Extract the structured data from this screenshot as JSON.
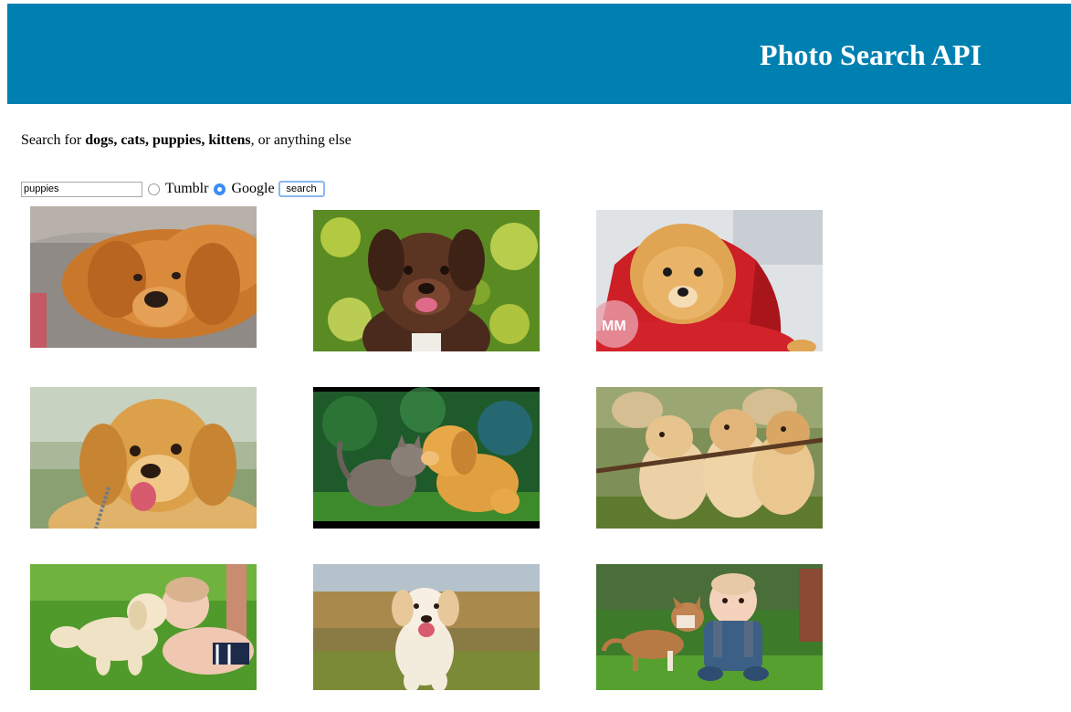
{
  "header": {
    "title": "Photo Search API"
  },
  "intro": {
    "prefix": "Search for ",
    "keywords": "dogs, cats, puppies, kittens",
    "suffix": ", or anything else"
  },
  "search": {
    "query": "puppies",
    "sources": [
      {
        "label": "Tumblr",
        "selected": false
      },
      {
        "label": "Google",
        "selected": true
      }
    ],
    "button_label": "search"
  },
  "results": [
    {
      "icon": "golden-puppy-lying-photo"
    },
    {
      "icon": "brown-puppy-bokeh-photo"
    },
    {
      "icon": "pomeranian-red-hoodie-photo"
    },
    {
      "icon": "golden-retriever-puppy-smiling-photo"
    },
    {
      "icon": "kitten-and-puppy-photo"
    },
    {
      "icon": "three-puppies-with-stick-photo"
    },
    {
      "icon": "puppy-kissing-baby-photo"
    },
    {
      "icon": "puppy-running-grass-photo"
    },
    {
      "icon": "baby-with-puppy-photo"
    }
  ],
  "colors": {
    "header_bg": "#0080b1",
    "header_text": "#ffffff",
    "radio_checked": "#3b8df5",
    "button_focus": "#8ab7f0"
  }
}
